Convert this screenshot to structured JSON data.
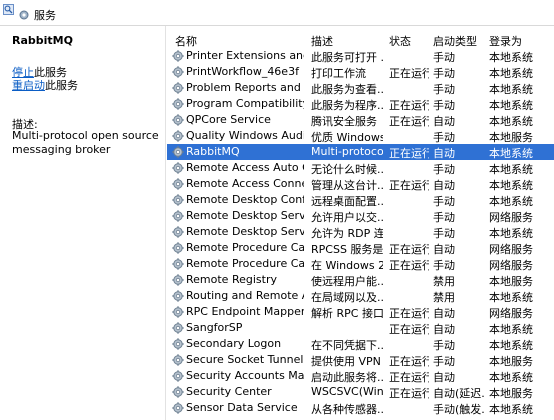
{
  "window": {
    "tab_label": "服务"
  },
  "description_panel": {
    "service_name": "RabbitMQ",
    "stop_link": "停止",
    "stop_suffix": "此服务",
    "restart_link": "重启动",
    "restart_suffix": "此服务",
    "desc_label": "描述:",
    "desc_text": "Multi-protocol open source messaging broker"
  },
  "table": {
    "columns": [
      "名称",
      "描述",
      "状态",
      "启动类型",
      "登录为"
    ],
    "rows": [
      {
        "name": "Printer Extensions and Noti...",
        "desc": "此服务可打开 ...",
        "status": "",
        "startup": "手动",
        "logon": "本地系统"
      },
      {
        "name": "PrintWorkflow_46e3f",
        "desc": "打印工作流",
        "status": "正在运行",
        "startup": "手动",
        "logon": "本地系统"
      },
      {
        "name": "Problem Reports and Solut...",
        "desc": "此服务为查看...",
        "status": "",
        "startup": "手动",
        "logon": "本地系统"
      },
      {
        "name": "Program Compatibility Assi...",
        "desc": "此服务为程序...",
        "status": "正在运行",
        "startup": "手动",
        "logon": "本地系统"
      },
      {
        "name": "QPCore Service",
        "desc": "腾讯安全服务",
        "status": "正在运行",
        "startup": "自动",
        "logon": "本地系统"
      },
      {
        "name": "Quality Windows Audio Vi...",
        "desc": "优质 Windows ...",
        "status": "",
        "startup": "手动",
        "logon": "本地服务"
      },
      {
        "name": "RabbitMQ",
        "desc": "Multi-protocol ...",
        "status": "正在运行",
        "startup": "自动",
        "logon": "本地系统"
      },
      {
        "name": "Remote Access Auto Conn...",
        "desc": "无论什么时候...",
        "status": "",
        "startup": "手动",
        "logon": "本地系统"
      },
      {
        "name": "Remote Access Connectio...",
        "desc": "管理从这台计...",
        "status": "正在运行",
        "startup": "自动",
        "logon": "本地系统"
      },
      {
        "name": "Remote Desktop Configur...",
        "desc": "远程桌面配置...",
        "status": "",
        "startup": "手动",
        "logon": "本地系统"
      },
      {
        "name": "Remote Desktop Services",
        "desc": "允许用户以交...",
        "status": "",
        "startup": "手动",
        "logon": "网络服务"
      },
      {
        "name": "Remote Desktop Services ...",
        "desc": "允许为 RDP 连...",
        "status": "",
        "startup": "手动",
        "logon": "本地系统"
      },
      {
        "name": "Remote Procedure Call (R...",
        "desc": "RPCSS 服务是 ...",
        "status": "正在运行",
        "startup": "自动",
        "logon": "网络服务"
      },
      {
        "name": "Remote Procedure Call (R...",
        "desc": "在 Windows 2...",
        "status": "正在运行",
        "startup": "手动",
        "logon": "网络服务"
      },
      {
        "name": "Remote Registry",
        "desc": "使远程用户能...",
        "status": "",
        "startup": "禁用",
        "logon": "本地服务"
      },
      {
        "name": "Routing and Remote Access",
        "desc": "在局域网以及...",
        "status": "",
        "startup": "禁用",
        "logon": "本地系统"
      },
      {
        "name": "RPC Endpoint Mapper",
        "desc": "解析 RPC 接口...",
        "status": "正在运行",
        "startup": "自动",
        "logon": "网络服务"
      },
      {
        "name": "SangforSP",
        "desc": "",
        "status": "正在运行",
        "startup": "自动",
        "logon": "本地系统"
      },
      {
        "name": "Secondary Logon",
        "desc": "在不同凭据下...",
        "status": "",
        "startup": "手动",
        "logon": "本地系统"
      },
      {
        "name": "Secure Socket Tunneling P...",
        "desc": "提供使用 VPN ...",
        "status": "正在运行",
        "startup": "手动",
        "logon": "本地服务"
      },
      {
        "name": "Security Accounts Manager",
        "desc": "启动此服务将...",
        "status": "正在运行",
        "startup": "自动",
        "logon": "本地系统"
      },
      {
        "name": "Security Center",
        "desc": "WSCSVC(Win...",
        "status": "正在运行",
        "startup": "自动(延迟...",
        "logon": "本地服务"
      },
      {
        "name": "Sensor Data Service",
        "desc": "从各种传感器...",
        "status": "",
        "startup": "手动(触发...",
        "logon": "本地系统"
      }
    ],
    "selected_index": 6
  },
  "colors": {
    "selection": "#2f71d4",
    "link": "#0b5dc5"
  }
}
